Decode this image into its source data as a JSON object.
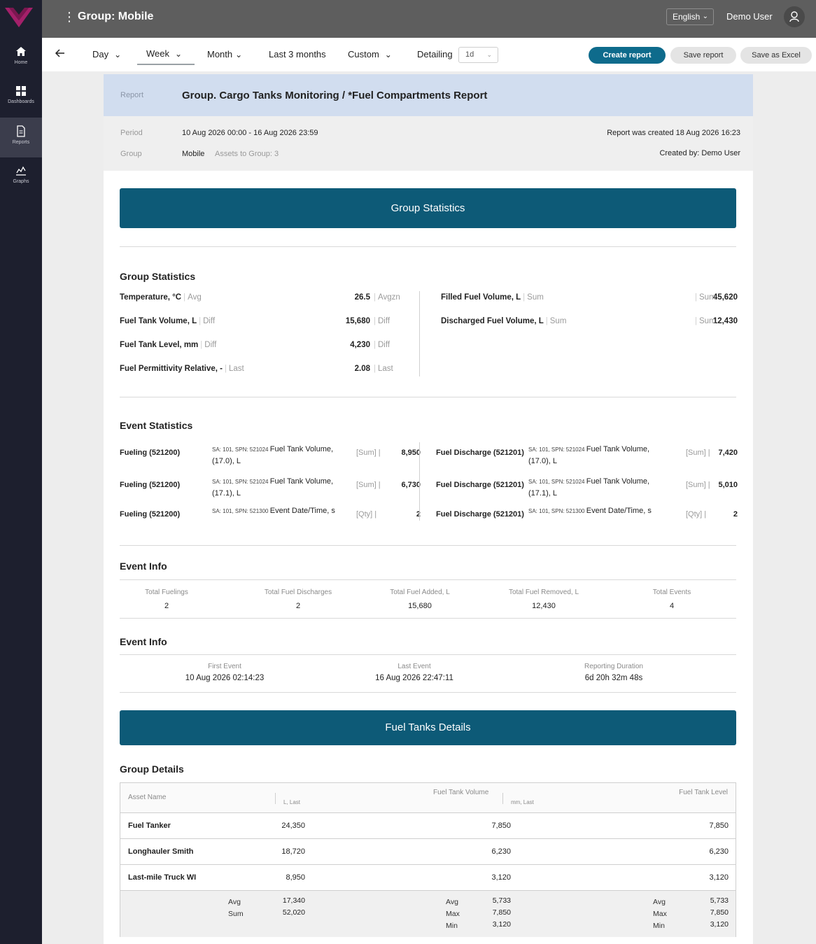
{
  "sidebar": {
    "items": [
      {
        "label": "Home",
        "icon": "home-icon"
      },
      {
        "label": "Dashboards",
        "icon": "dashboards-icon"
      },
      {
        "label": "Reports",
        "icon": "reports-icon"
      },
      {
        "label": "Graphs",
        "icon": "graphs-icon"
      }
    ],
    "active": "Reports"
  },
  "topbar": {
    "title": "Group: Mobile",
    "language": "English",
    "user": "Demo User"
  },
  "toolbar": {
    "periods": [
      "Day",
      "Week",
      "Month",
      "Last 3 months",
      "Custom"
    ],
    "selected_period": "Week",
    "detailing_label": "Detailing",
    "detailing_value": "1d",
    "create_report": "Create report",
    "save_report": "Save report",
    "save_excel": "Save as Excel"
  },
  "report": {
    "label": "Report",
    "title": "Group. Cargo Tanks Monitoring / *Fuel Compartments Report",
    "period_label": "Period",
    "period": "10 Aug 2026 00:00 - 16 Aug 2026 23:59",
    "group_label": "Group",
    "group": "Mobile",
    "assets": "Assets to Group: 3",
    "created_at": "Report was created 18 Aug 2026 16:23",
    "created_by": "Created by: Demo User"
  },
  "banners": {
    "group_statistics": "Group Statistics",
    "fuel_tanks_details": "Fuel Tanks Details"
  },
  "group_statistics": {
    "title": "Group Statistics",
    "left": [
      {
        "name": "Temperature, °C",
        "agg": "Avg",
        "value": "26.5",
        "vagg": "Avgzn"
      },
      {
        "name": "Fuel Tank Volume, L",
        "agg": "Diff",
        "value": "15,680",
        "vagg": "Diff"
      },
      {
        "name": "Fuel Tank Level, mm",
        "agg": "Diff",
        "value": "4,230",
        "vagg": "Diff"
      },
      {
        "name": "Fuel Permittivity Relative, -",
        "agg": "Last",
        "value": "2.08",
        "vagg": "Last"
      }
    ],
    "right": [
      {
        "name": "Filled Fuel Volume, L",
        "agg": "Sum",
        "value": "45,620",
        "vagg": "Sum"
      },
      {
        "name": "Discharged Fuel Volume, L",
        "agg": "Sum",
        "value": "12,430",
        "vagg": "Sum"
      }
    ]
  },
  "event_statistics": {
    "title": "Event Statistics",
    "left": [
      {
        "event": "Fueling (521200)",
        "sa": "SA: 101, SPN: 521024",
        "signal": "Fuel Tank Volume, (17.0), L",
        "agg": "[Sum]",
        "value": "8,950"
      },
      {
        "event": "Fueling (521200)",
        "sa": "SA: 101, SPN: 521024",
        "signal": "Fuel Tank Volume, (17.1), L",
        "agg": "[Sum]",
        "value": "6,730"
      },
      {
        "event": "Fueling (521200)",
        "sa": "SA: 101, SPN: 521300",
        "signal": "Event Date/Time, s",
        "agg": "[Qty]",
        "value": "2"
      }
    ],
    "right": [
      {
        "event": "Fuel Discharge (521201)",
        "sa": "SA: 101, SPN: 521024",
        "signal": "Fuel Tank Volume, (17.0), L",
        "agg": "[Sum]",
        "value": "7,420"
      },
      {
        "event": "Fuel Discharge (521201)",
        "sa": "SA: 101, SPN: 521024",
        "signal": "Fuel Tank Volume, (17.1), L",
        "agg": "[Sum]",
        "value": "5,010"
      },
      {
        "event": "Fuel Discharge (521201)",
        "sa": "SA: 101, SPN: 521300",
        "signal": "Event Date/Time, s",
        "agg": "[Qty]",
        "value": "2"
      }
    ]
  },
  "event_info_1": {
    "title": "Event Info",
    "items": [
      {
        "label": "Total  Fuelings",
        "value": "2"
      },
      {
        "label": "Total  Fuel Discharges",
        "value": "2"
      },
      {
        "label": "Total  Fuel Added,  L",
        "value": "15,680"
      },
      {
        "label": "Total  Fuel  Removed,  L",
        "value": "12,430"
      },
      {
        "label": "Total  Events",
        "value": "4"
      }
    ]
  },
  "event_info_2": {
    "title": "Event Info",
    "items": [
      {
        "label": "First  Event",
        "value": "10 Aug 2026 02:14:23"
      },
      {
        "label": "Last  Event",
        "value": "16 Aug 2026 22:47:11"
      },
      {
        "label": "Reporting Duration",
        "value": "6d 20h 32m 48s"
      }
    ]
  },
  "group_details": {
    "title": "Group Details",
    "headers": {
      "asset": "Asset Name",
      "unit1": "L, Last",
      "col2": "Fuel Tank Volume",
      "unit2": "mm, Last",
      "col3": "Fuel Tank Level"
    },
    "rows": [
      {
        "name": "Fuel Tanker",
        "c1": "24,350",
        "c2": "7,850",
        "c3": "7,850"
      },
      {
        "name": "Longhauler Smith",
        "c1": "18,720",
        "c2": "6,230",
        "c3": "6,230"
      },
      {
        "name": "Last-mile Truck WI",
        "c1": "8,950",
        "c2": "3,120",
        "c3": "3,120"
      }
    ],
    "footer": {
      "c1_labels": [
        "Avg",
        "Sum"
      ],
      "c1_values": [
        "17,340",
        "52,020"
      ],
      "c2_labels": [
        "Avg",
        "Max",
        "Min"
      ],
      "c2_values": [
        "5,733",
        "7,850",
        "3,120"
      ],
      "c3_labels": [
        "Avg",
        "Max",
        "Min"
      ],
      "c3_values": [
        "5,733",
        "7,850",
        "3,120"
      ]
    }
  },
  "colors": {
    "sidebar": "#1d1f2e",
    "topbar": "#5e5e5e",
    "accent": "#0e6b8c",
    "banner": "#0d5a77",
    "report_header": "#d1ddef",
    "logo": "#a4206a"
  }
}
